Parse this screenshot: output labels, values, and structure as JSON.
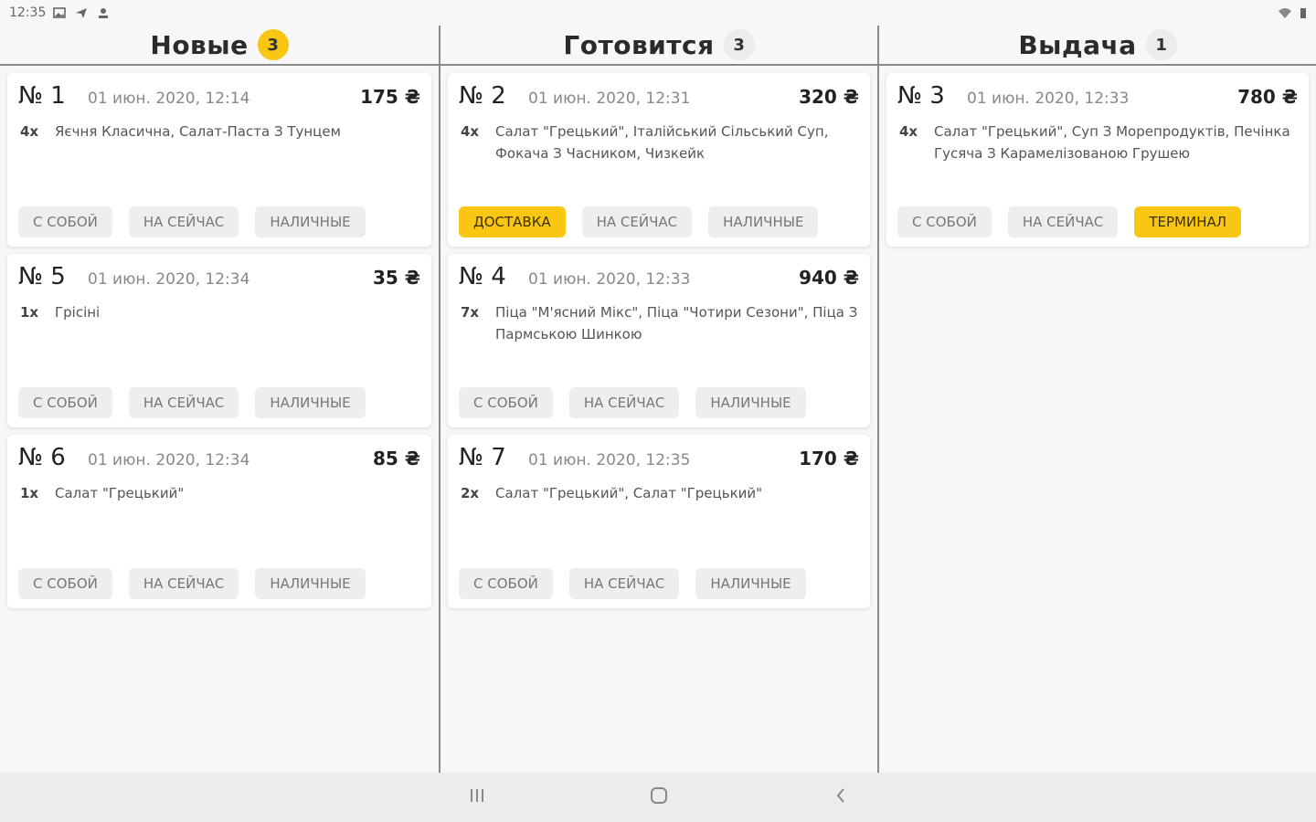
{
  "statusbar": {
    "time": "12:35"
  },
  "columns": [
    {
      "title": "Новые",
      "count": "3",
      "orders": [
        {
          "num": "№ 1",
          "date": "01 июн. 2020, 12:14",
          "price": "175 ₴",
          "qty": "4x",
          "items": "Яєчня Класична, Салат-Паста З Тунцем",
          "tags": [
            "С СОБОЙ",
            "НА СЕЙЧАС",
            "НАЛИЧНЫЕ"
          ]
        },
        {
          "num": "№ 5",
          "date": "01 июн. 2020, 12:34",
          "price": "35 ₴",
          "qty": "1x",
          "items": "Грісіні",
          "tags": [
            "С СОБОЙ",
            "НА СЕЙЧАС",
            "НАЛИЧНЫЕ"
          ]
        },
        {
          "num": "№ 6",
          "date": "01 июн. 2020, 12:34",
          "price": "85 ₴",
          "qty": "1x",
          "items": "Салат \"Грецький\"",
          "tags": [
            "С СОБОЙ",
            "НА СЕЙЧАС",
            "НАЛИЧНЫЕ"
          ]
        }
      ]
    },
    {
      "title": "Готовится",
      "count": "3",
      "orders": [
        {
          "num": "№ 2",
          "date": "01 июн. 2020, 12:31",
          "price": "320 ₴",
          "qty": "4x",
          "items": "Салат \"Грецький\", Італійський Сільський Суп, Фокача З Часником, Чизкейк",
          "tags": [
            "ДОСТАВКА",
            "НА СЕЙЧАС",
            "НАЛИЧНЫЕ"
          ]
        },
        {
          "num": "№ 4",
          "date": "01 июн. 2020, 12:33",
          "price": "940 ₴",
          "qty": "7x",
          "items": "Піца \"М'ясний Мікс\", Піца \"Чотири Сезони\", Піца З Пармською Шинкою",
          "tags": [
            "С СОБОЙ",
            "НА СЕЙЧАС",
            "НАЛИЧНЫЕ"
          ]
        },
        {
          "num": "№ 7",
          "date": "01 июн. 2020, 12:35",
          "price": "170 ₴",
          "qty": "2x",
          "items": "Салат \"Грецький\", Салат \"Грецький\"",
          "tags": [
            "С СОБОЙ",
            "НА СЕЙЧАС",
            "НАЛИЧНЫЕ"
          ]
        }
      ]
    },
    {
      "title": "Выдача",
      "count": "1",
      "orders": [
        {
          "num": "№ 3",
          "date": "01 июн. 2020, 12:33",
          "price": "780 ₴",
          "qty": "4x",
          "items": "Салат \"Грецький\", Суп З Морепродуктів, Печінка Гусяча З Карамелізованою Грушею",
          "tags": [
            "С СОБОЙ",
            "НА СЕЙЧАС",
            "ТЕРМИНАЛ"
          ]
        }
      ]
    }
  ],
  "colors": {
    "accent": "#f8c613",
    "tag_bg": "#eeeeee"
  },
  "icons": {
    "status": [
      "image-icon",
      "send-icon",
      "person-icon",
      "wifi-icon",
      "battery-icon"
    ],
    "nav": [
      "recent-apps-icon",
      "home-icon",
      "back-icon"
    ]
  }
}
